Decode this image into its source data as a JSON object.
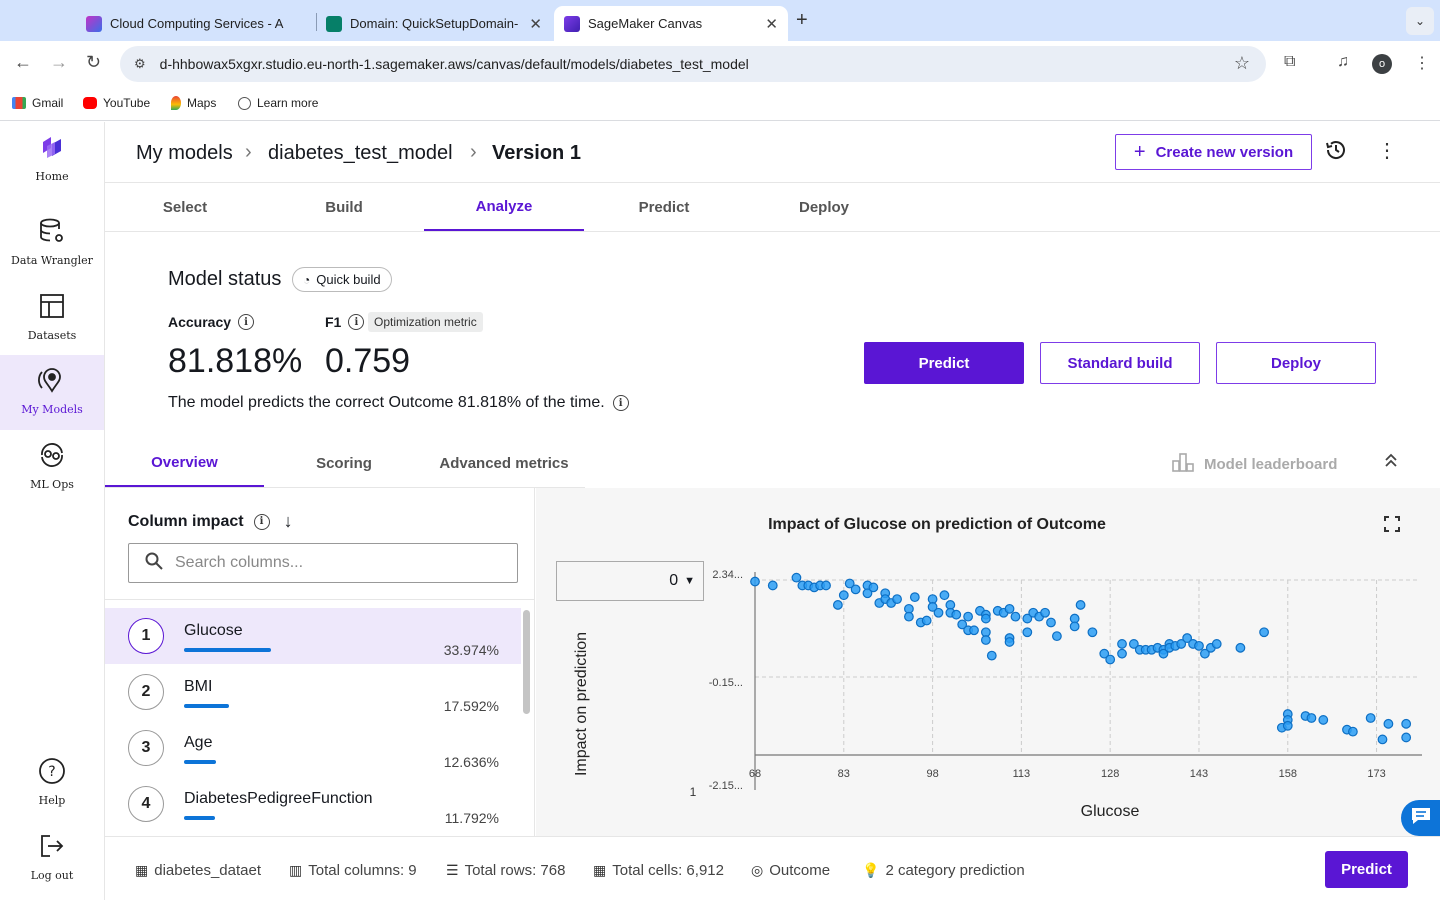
{
  "browser": {
    "tabs": [
      {
        "title": "Cloud Computing Services - A",
        "color": "#c233c6"
      },
      {
        "title": "Domain: QuickSetupDomain-",
        "color": "#067f68"
      },
      {
        "title": "SageMaker Canvas",
        "color": "#5a16d4"
      }
    ],
    "new_tab": "+",
    "url": "d-hhbowax5xgxr.studio.eu-north-1.sagemaker.aws/canvas/default/models/diabetes_test_model",
    "profile_initial": "o",
    "bookmarks": [
      "Gmail",
      "YouTube",
      "Maps",
      "Learn more"
    ]
  },
  "sidebar": {
    "items": [
      {
        "label": "Home"
      },
      {
        "label": "Data Wrangler"
      },
      {
        "label": "Datasets"
      },
      {
        "label": "My Models"
      },
      {
        "label": "ML Ops"
      },
      {
        "label": "Help"
      },
      {
        "label": "Log out"
      }
    ]
  },
  "header": {
    "breadcrumbs": [
      "My models",
      "diabetes_test_model",
      "Version 1"
    ],
    "create_label": "Create new version"
  },
  "steps": [
    "Select",
    "Build",
    "Analyze",
    "Predict",
    "Deploy"
  ],
  "status": {
    "title": "Model status",
    "badge": "Quick build",
    "accuracy_label": "Accuracy",
    "accuracy_value": "81.818%",
    "f1_label": "F1",
    "optimization_badge": "Optimization metric",
    "f1_value": "0.759",
    "description": "The model predicts the correct Outcome 81.818% of the time."
  },
  "actions": {
    "predict": "Predict",
    "standard_build": "Standard build",
    "deploy": "Deploy"
  },
  "subtabs": [
    "Overview",
    "Scoring",
    "Advanced metrics"
  ],
  "leaderboard": "Model leaderboard",
  "column_impact": {
    "title": "Column impact",
    "search_placeholder": "Search columns...",
    "columns": [
      {
        "rank": "1",
        "name": "Glucose",
        "pct": "33.974%",
        "fraction": 0.33974
      },
      {
        "rank": "2",
        "name": "BMI",
        "pct": "17.592%",
        "fraction": 0.17592
      },
      {
        "rank": "3",
        "name": "Age",
        "pct": "12.636%",
        "fraction": 0.12636
      },
      {
        "rank": "4",
        "name": "DiabetesPedigreeFunction",
        "pct": "11.792%",
        "fraction": 0.11792
      }
    ]
  },
  "chart_panel": {
    "class_value": "0"
  },
  "chart_data": {
    "type": "scatter",
    "title": "Impact of Glucose on prediction of Outcome",
    "xlabel": "Glucose",
    "ylabel": "Impact on prediction",
    "x_ticks": [
      "68",
      "83",
      "98",
      "113",
      "128",
      "143",
      "158",
      "173"
    ],
    "y_ticks": [
      "2.34...",
      "-0.15...",
      "-2.15..."
    ],
    "extra_label": "1",
    "xlim": [
      68,
      180
    ],
    "ylim": [
      -2.15,
      2.34
    ],
    "color": "#2a9df4",
    "points": [
      [
        68,
        2.3
      ],
      [
        71,
        2.2
      ],
      [
        75,
        2.4
      ],
      [
        76,
        2.2
      ],
      [
        77,
        2.2
      ],
      [
        78,
        2.15
      ],
      [
        79,
        2.2
      ],
      [
        80,
        2.2
      ],
      [
        82,
        1.7
      ],
      [
        83,
        1.95
      ],
      [
        84,
        2.25
      ],
      [
        85,
        2.1
      ],
      [
        87,
        2.2
      ],
      [
        87,
        2.0
      ],
      [
        88,
        2.15
      ],
      [
        89,
        1.75
      ],
      [
        90,
        2.0
      ],
      [
        90,
        1.85
      ],
      [
        91,
        1.75
      ],
      [
        92,
        1.85
      ],
      [
        94,
        1.6
      ],
      [
        94,
        1.4
      ],
      [
        95,
        1.9
      ],
      [
        96,
        1.25
      ],
      [
        97,
        1.3
      ],
      [
        98,
        1.85
      ],
      [
        98,
        1.65
      ],
      [
        99,
        1.5
      ],
      [
        100,
        1.95
      ],
      [
        101,
        1.7
      ],
      [
        101,
        1.5
      ],
      [
        102,
        1.45
      ],
      [
        103,
        1.2
      ],
      [
        104,
        1.4
      ],
      [
        104,
        1.05
      ],
      [
        105,
        1.05
      ],
      [
        106,
        1.55
      ],
      [
        107,
        1.45
      ],
      [
        107,
        1.35
      ],
      [
        107,
        1.0
      ],
      [
        107,
        0.8
      ],
      [
        108,
        0.4
      ],
      [
        109,
        1.55
      ],
      [
        110,
        1.5
      ],
      [
        111,
        1.6
      ],
      [
        111,
        0.85
      ],
      [
        111,
        0.75
      ],
      [
        112,
        1.4
      ],
      [
        114,
        1.35
      ],
      [
        114,
        1.0
      ],
      [
        115,
        1.5
      ],
      [
        116,
        1.4
      ],
      [
        117,
        1.5
      ],
      [
        118,
        1.25
      ],
      [
        119,
        0.9
      ],
      [
        122,
        1.35
      ],
      [
        122,
        1.15
      ],
      [
        123,
        1.7
      ],
      [
        125,
        1.0
      ],
      [
        127,
        0.45
      ],
      [
        128,
        0.3
      ],
      [
        130,
        0.7
      ],
      [
        130,
        0.45
      ],
      [
        132,
        0.7
      ],
      [
        133,
        0.55
      ],
      [
        134,
        0.55
      ],
      [
        135,
        0.55
      ],
      [
        136,
        0.6
      ],
      [
        137,
        0.55
      ],
      [
        137,
        0.45
      ],
      [
        138,
        0.7
      ],
      [
        138,
        0.6
      ],
      [
        139,
        0.65
      ],
      [
        140,
        0.7
      ],
      [
        141,
        0.85
      ],
      [
        142,
        0.7
      ],
      [
        143,
        0.65
      ],
      [
        144,
        0.45
      ],
      [
        145,
        0.6
      ],
      [
        146,
        0.7
      ],
      [
        150,
        0.6
      ],
      [
        154,
        1.0
      ],
      [
        157,
        -1.45
      ],
      [
        158,
        -1.1
      ],
      [
        158,
        -1.25
      ],
      [
        158,
        -1.4
      ],
      [
        161,
        -1.15
      ],
      [
        162,
        -1.2
      ],
      [
        164,
        -1.25
      ],
      [
        168,
        -1.5
      ],
      [
        169,
        -1.55
      ],
      [
        172,
        -1.2
      ],
      [
        174,
        -1.75
      ],
      [
        175,
        -1.35
      ],
      [
        178,
        -1.35
      ],
      [
        178,
        -1.7
      ]
    ]
  },
  "footer": {
    "dataset": "diabetes_dataet",
    "columns": "Total columns: 9",
    "rows": "Total rows: 768",
    "cells": "Total cells: 6,912",
    "target": "Outcome",
    "prediction_type": "2 category prediction",
    "predict": "Predict"
  }
}
